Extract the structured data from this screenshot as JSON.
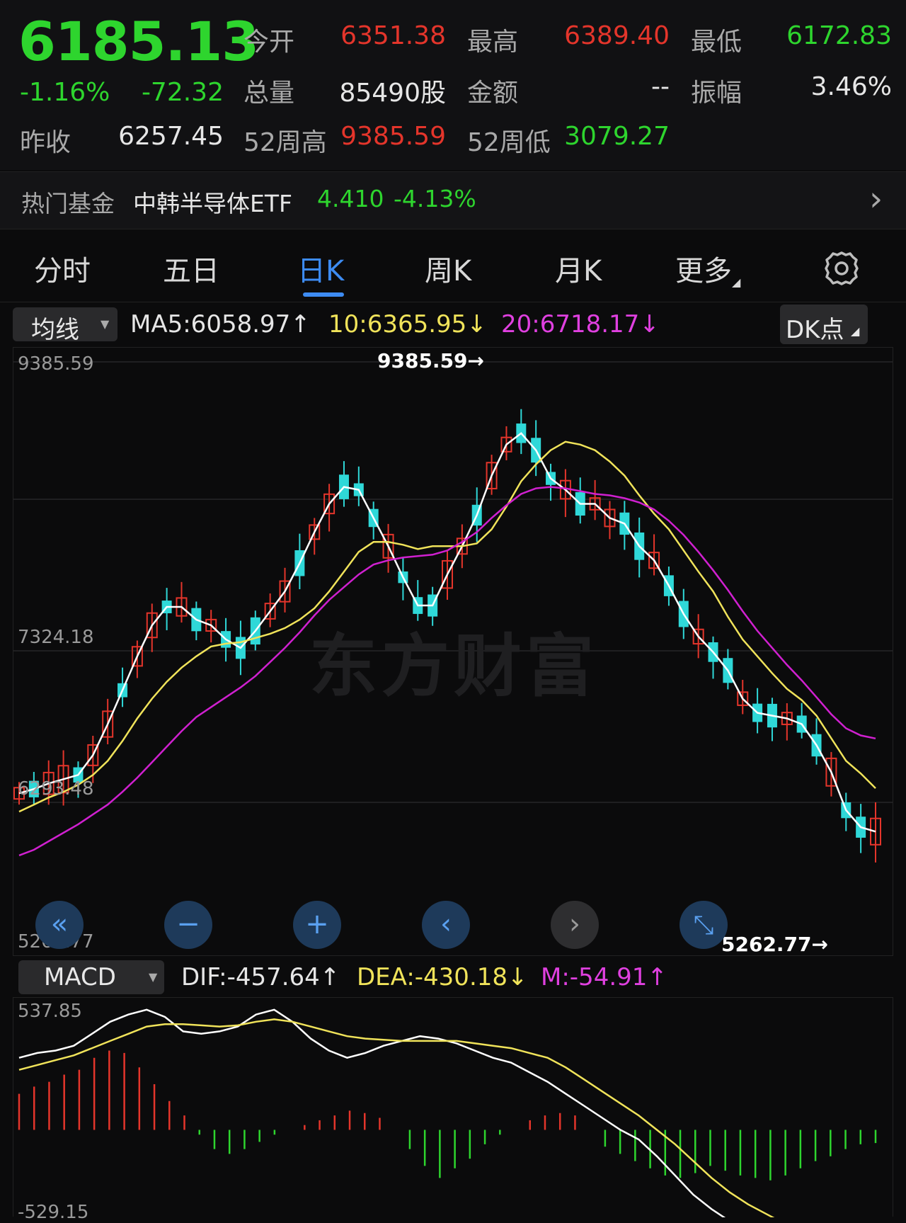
{
  "quote": {
    "price": "6185.13",
    "change_pct": "-1.16%",
    "change": "-72.32",
    "prev_close_label": "昨收",
    "prev_close": "6257.45",
    "open_label": "今开",
    "open": "6351.38",
    "high_label": "最高",
    "high": "6389.40",
    "low_label": "最低",
    "low": "6172.83",
    "volume_label": "总量",
    "volume": "85490股",
    "amount_label": "金额",
    "amount": "--",
    "amplitude_label": "振幅",
    "amplitude": "3.46%",
    "wk52_high_label": "52周高",
    "wk52_high": "9385.59",
    "wk52_low_label": "52周低",
    "wk52_low": "3079.27"
  },
  "fund": {
    "label": "热门基金",
    "name": "中韩半导体ETF",
    "price": "4.410",
    "change": "-4.13%",
    "arrow": "›"
  },
  "tabs": [
    "分时",
    "五日",
    "日K",
    "周K",
    "月K",
    "更多"
  ],
  "active_tab": "日K",
  "ma": {
    "selector": "均线",
    "ma5": "MA5:6058.97↑",
    "ma10": "10:6365.95↓",
    "ma20": "20:6718.17↓",
    "dk": "DK点"
  },
  "k_axis": [
    "9385.59",
    "7324.18",
    "6293.48",
    "5262.77"
  ],
  "k_annotations": {
    "max": "9385.59→",
    "min": "5262.77→"
  },
  "watermark": "东方财富",
  "macd": {
    "selector": "MACD",
    "dif": "DIF:-457.64↑",
    "dea": "DEA:-430.18↓",
    "m": "M:-54.91↑",
    "axis_top": "537.85",
    "axis_bottom": "-529.15"
  },
  "colors": {
    "up": "#e4352b",
    "down": "#2fd8d8",
    "ma5": "#ffffff",
    "ma10": "#f0e35a",
    "ma20": "#d020d0",
    "macd_pos": "#e4352b",
    "macd_neg": "#2ed52e"
  },
  "chart_data": [
    {
      "type": "candlestick",
      "title": "日K",
      "ylim": [
        5262.77,
        9385.59
      ],
      "series": [
        {
          "name": "MA5",
          "values": [
            6330,
            6360,
            6400,
            6430,
            6460,
            6600,
            6820,
            7060,
            7300,
            7520,
            7650,
            7650,
            7560,
            7520,
            7420,
            7360,
            7480,
            7620,
            7760,
            7960,
            8180,
            8380,
            8500,
            8480,
            8280,
            8080,
            7860,
            7660,
            7660,
            7880,
            8080,
            8300,
            8580,
            8800,
            8880,
            8760,
            8560,
            8480,
            8380,
            8380,
            8280,
            8240,
            8080,
            7980,
            7800,
            7600,
            7440,
            7330,
            7200,
            7000,
            6900,
            6880,
            6860,
            6820,
            6670,
            6480,
            6210,
            6090,
            6058.97
          ]
        },
        {
          "name": "10",
          "values": [
            6200,
            6250,
            6300,
            6340,
            6390,
            6460,
            6560,
            6700,
            6860,
            7000,
            7120,
            7220,
            7300,
            7370,
            7390,
            7400,
            7430,
            7460,
            7500,
            7560,
            7640,
            7760,
            7900,
            8040,
            8110,
            8110,
            8090,
            8060,
            8080,
            8080,
            8080,
            8100,
            8200,
            8360,
            8540,
            8660,
            8760,
            8820,
            8800,
            8760,
            8680,
            8580,
            8440,
            8310,
            8200,
            8050,
            7900,
            7760,
            7580,
            7420,
            7300,
            7180,
            7070,
            6990,
            6880,
            6720,
            6560,
            6470,
            6365.95
          ]
        },
        {
          "name": "20",
          "values": [
            5890,
            5930,
            5990,
            6050,
            6110,
            6180,
            6250,
            6340,
            6440,
            6550,
            6660,
            6770,
            6870,
            6940,
            7010,
            7080,
            7160,
            7260,
            7360,
            7470,
            7590,
            7700,
            7790,
            7880,
            7950,
            7980,
            8000,
            8010,
            8020,
            8050,
            8110,
            8180,
            8280,
            8370,
            8450,
            8490,
            8500,
            8490,
            8470,
            8450,
            8440,
            8420,
            8390,
            8340,
            8260,
            8160,
            8040,
            7910,
            7770,
            7620,
            7480,
            7360,
            7240,
            7130,
            7010,
            6890,
            6790,
            6740,
            6718.17
          ]
        }
      ]
    },
    {
      "type": "bar",
      "title": "MACD",
      "ylim": [
        -529.15,
        537.85
      ],
      "series": [
        {
          "name": "DIF",
          "values": [
            300,
            320,
            330,
            350,
            400,
            450,
            480,
            500,
            470,
            410,
            400,
            410,
            430,
            480,
            500,
            450,
            380,
            330,
            300,
            320,
            350,
            370,
            390,
            380,
            360,
            330,
            300,
            280,
            240,
            200,
            150,
            100,
            50,
            0,
            -40,
            -110,
            -190,
            -270,
            -330,
            -380,
            -420,
            -460,
            -480,
            -490,
            -485,
            -480,
            -470,
            -457.64
          ]
        },
        {
          "name": "DEA",
          "values": [
            250,
            270,
            290,
            310,
            340,
            370,
            400,
            430,
            440,
            440,
            435,
            430,
            435,
            450,
            460,
            450,
            430,
            410,
            390,
            380,
            375,
            370,
            370,
            370,
            370,
            360,
            350,
            340,
            320,
            300,
            260,
            210,
            160,
            110,
            60,
            0,
            -60,
            -130,
            -200,
            -260,
            -310,
            -350,
            -390,
            -410,
            -425,
            -430,
            -430,
            -430.18
          ]
        },
        {
          "name": "M",
          "values": [
            150,
            180,
            200,
            230,
            250,
            300,
            330,
            320,
            260,
            190,
            120,
            60,
            -20,
            -80,
            -100,
            -80,
            -50,
            -20,
            0,
            20,
            40,
            60,
            80,
            70,
            50,
            0,
            -80,
            -150,
            -200,
            -160,
            -120,
            -60,
            -20,
            0,
            40,
            60,
            70,
            60,
            0,
            -70,
            -100,
            -130,
            -160,
            -190,
            -200,
            -180,
            -150,
            -170,
            -190,
            -200,
            -210,
            -190,
            -160,
            -130,
            -110,
            -80,
            -60,
            -54.91
          ]
        }
      ]
    }
  ]
}
